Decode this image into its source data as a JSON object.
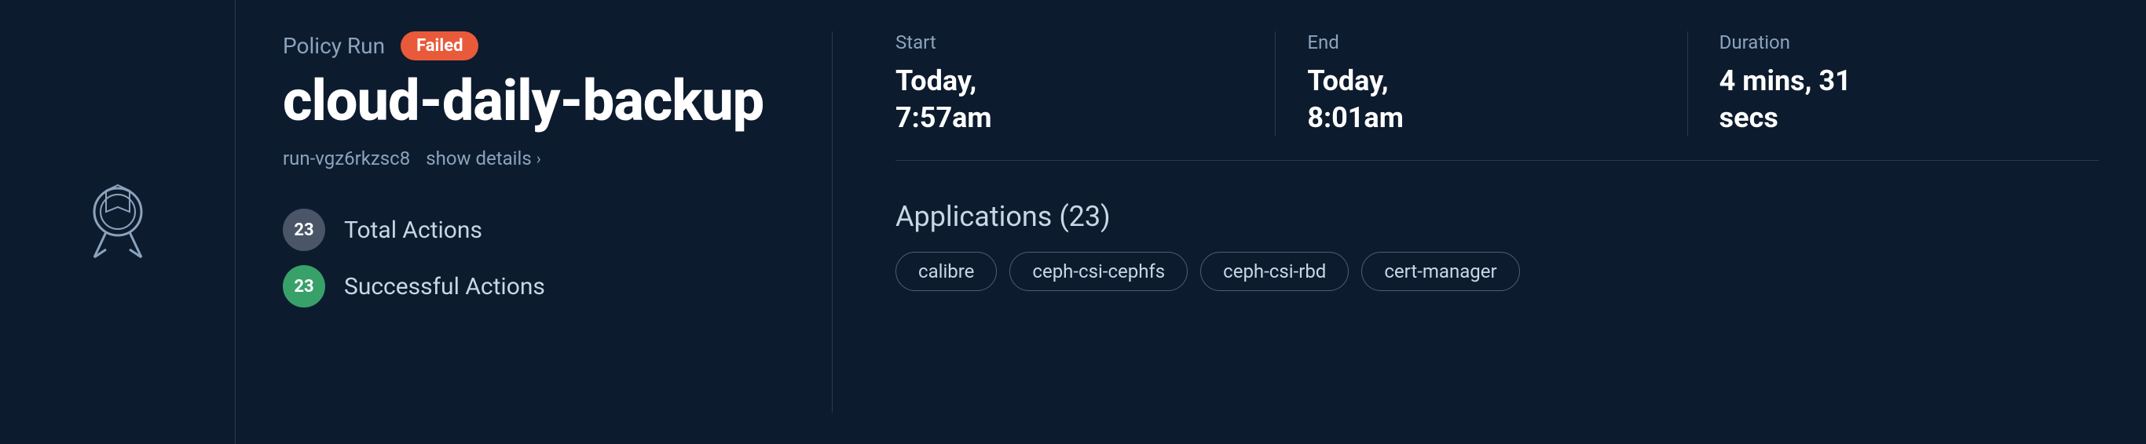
{
  "leftPanel": {
    "iconAlt": "policy-run-medal"
  },
  "header": {
    "policyRunLabel": "Policy Run",
    "failedBadge": "Failed",
    "policyName": "cloud-daily-backup",
    "runId": "run-vgz6rkzsc8",
    "showDetailsLabel": "show details"
  },
  "stats": {
    "totalActions": {
      "count": "23",
      "label": "Total Actions"
    },
    "successfulActions": {
      "count": "23",
      "label": "Successful Actions"
    }
  },
  "timing": {
    "start": {
      "label": "Start",
      "value": "Today, 7:57am"
    },
    "end": {
      "label": "End",
      "value": "Today, 8:01am"
    },
    "duration": {
      "label": "Duration",
      "value": "4 mins, 31 secs"
    }
  },
  "applications": {
    "title": "Applications",
    "count": "(23)",
    "tags": [
      "calibre",
      "ceph-csi-cephfs",
      "ceph-csi-rbd",
      "cert-manager"
    ]
  }
}
